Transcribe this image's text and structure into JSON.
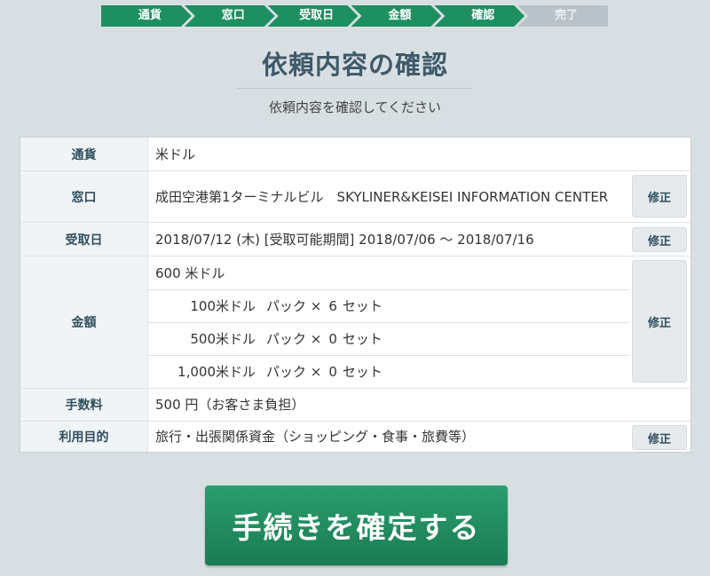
{
  "steps": [
    {
      "label": "通貨",
      "state": "done"
    },
    {
      "label": "窓口",
      "state": "done"
    },
    {
      "label": "受取日",
      "state": "done"
    },
    {
      "label": "金額",
      "state": "done"
    },
    {
      "label": "確認",
      "state": "current"
    },
    {
      "label": "完了",
      "state": "todo"
    }
  ],
  "title": "依頼内容の確認",
  "subtitle": "依頼内容を確認してください",
  "rows": {
    "currency": {
      "label": "通貨",
      "value": "米ドル"
    },
    "branch": {
      "label": "窓口",
      "value": "成田空港第1ターミナルビル　SKYLINER&KEISEI INFORMATION CENTER",
      "edit": "修正"
    },
    "date": {
      "label": "受取日",
      "value": "2018/07/12 (木) [受取可能期間] 2018/07/06 〜 2018/07/16",
      "edit": "修正"
    },
    "amount": {
      "label": "金額",
      "total": "600 米ドル",
      "edit": "修正",
      "packs": [
        {
          "name": "100米ドル",
          "pack": "パック ×",
          "count": "6",
          "unit": "セット"
        },
        {
          "name": "500米ドル",
          "pack": "パック ×",
          "count": "0",
          "unit": "セット"
        },
        {
          "name": "1,000米ドル",
          "pack": "パック ×",
          "count": "0",
          "unit": "セット"
        }
      ]
    },
    "fee": {
      "label": "手数料",
      "value": "500 円（お客さま負担）"
    },
    "purpose": {
      "label": "利用目的",
      "value": "旅行・出張関係資金（ショッピング・食事・旅費等）",
      "edit": "修正"
    }
  },
  "confirm_label": "手続きを確定する",
  "colors": {
    "primary": "#1e8f61",
    "pending": "#b8c2c8",
    "heading": "#3e5a6a"
  }
}
